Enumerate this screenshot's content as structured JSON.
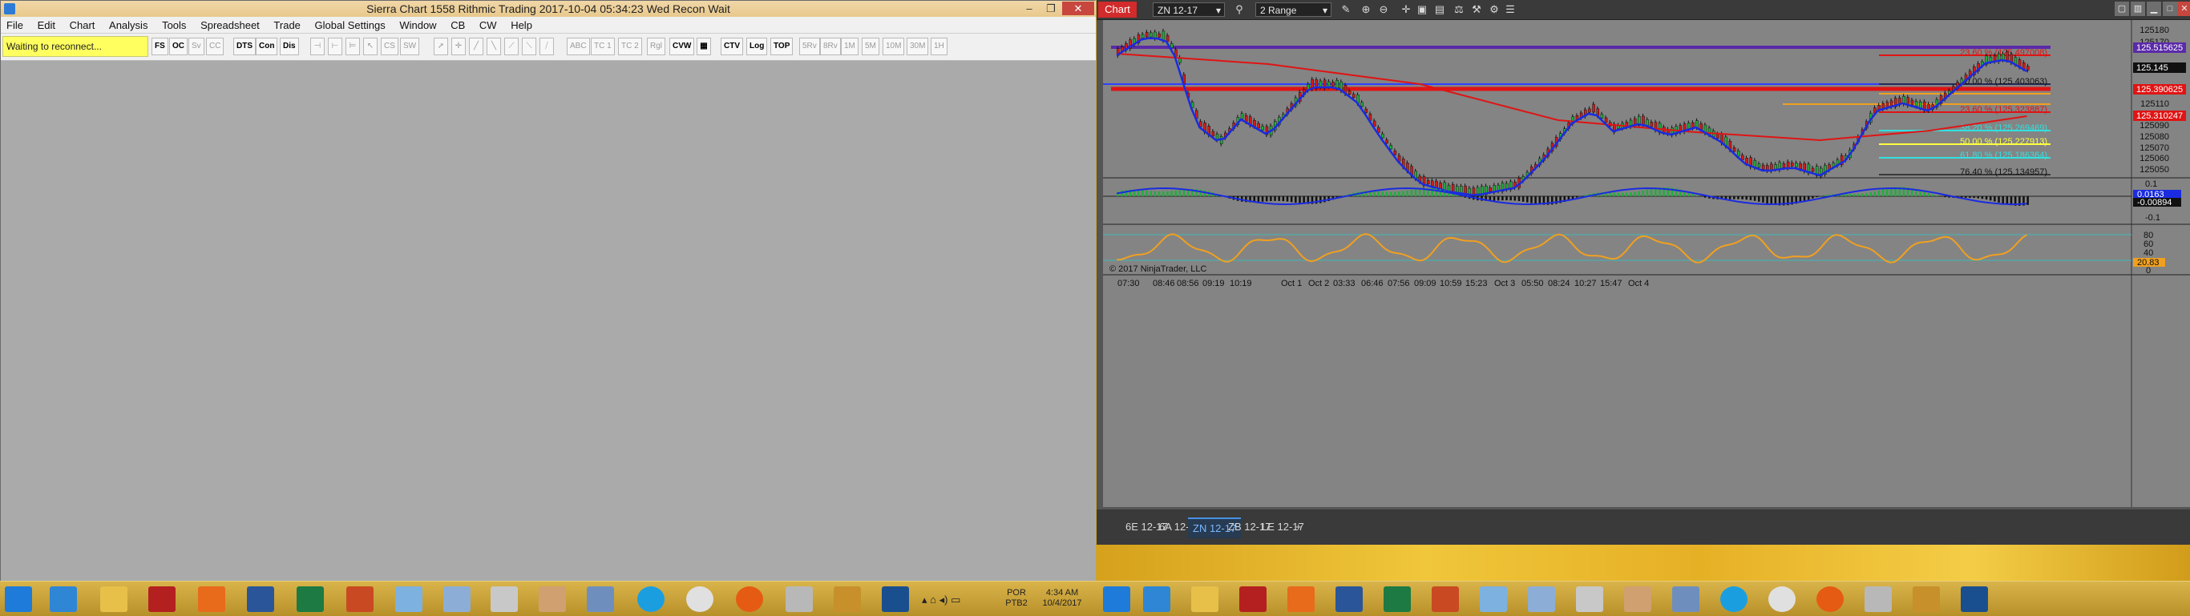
{
  "sierra": {
    "title": "Sierra Chart 1558 Rithmic Trading 2017-10-04  05:34:23 Wed  Recon Wait",
    "controls": {
      "minimize": "–",
      "restore": "❐",
      "close": "✕"
    },
    "menu": [
      "File",
      "Edit",
      "Chart",
      "Analysis",
      "Tools",
      "Spreadsheet",
      "Trade",
      "Global Settings",
      "Window",
      "CB",
      "CW",
      "Help"
    ],
    "status": "Waiting to reconnect...",
    "toolbar_buttons": [
      "FS",
      "OC",
      "Sv",
      "CC",
      "DTS",
      "Con",
      "Dis",
      "CVW",
      "CTV",
      "Log",
      "TOP"
    ],
    "toolbar_dim_buttons": [
      "Sv",
      "CC",
      "CS",
      "SW",
      "ABC",
      "TC 1",
      "TC 2",
      "Rgl",
      "5Rv",
      "8Rv",
      "1M",
      "5M",
      "10M",
      "30M",
      "1H"
    ]
  },
  "ninja": {
    "chart_tab": "Chart",
    "instrument": "ZN 12-17",
    "bar_type": "2 Range",
    "copyright": "© 2017 NinjaTrader, LLC",
    "tabs": [
      "6E 12-17",
      "6A 12-17",
      "ZN 12-17",
      "ZB 12-17",
      "LE 12-17",
      "+"
    ],
    "active_tab": "ZN 12-17"
  },
  "taskbar": {
    "lang_top": "POR",
    "lang_bottom": "PTB2",
    "time": "4:34 AM",
    "date": "10/4/2017"
  },
  "colors": {
    "title_bar": "#f1d7a8",
    "status_yellow": "#ffff60",
    "nt_red": "#d12b2b",
    "chart_bg": "#848484",
    "osc_orange": "#f0a020",
    "ema_blue": "#1a2be0",
    "sma_red": "#e01414"
  },
  "chart_data": {
    "type": "candlestick",
    "instrument": "ZN 12-17",
    "x_ticks": [
      "07:30",
      "08:46",
      "08:56",
      "09:19",
      "10:19",
      "Oct 1",
      "Oct 2",
      "03:33",
      "06:46",
      "07:56",
      "09:09",
      "10:59",
      "15:23",
      "Oct 3",
      "05:50",
      "08:24",
      "10:27",
      "15:47",
      "Oct 4"
    ],
    "price_ticks": [
      "125180",
      "125170",
      "125160",
      "125140",
      "125130",
      "125120",
      "125110",
      "125100",
      "125090",
      "125080",
      "125070",
      "125060",
      "125050"
    ],
    "price_labels": {
      "purple_line": "125.515625",
      "last_price": "125.145",
      "red_band": "125.390625",
      "red_low": "125.310247"
    },
    "fib_levels": [
      {
        "label": "23.60 % (125.497008)",
        "color": "#e01414"
      },
      {
        "label": "0.00 % (125.403063)",
        "color": "#222222"
      },
      {
        "label": "23.60 % (125.323887)",
        "color": "#e01414"
      },
      {
        "label": "38.20 % (125.269469)",
        "color": "#32e0e0"
      },
      {
        "label": "50.00 % (125.227913)",
        "color": "#ffff40"
      },
      {
        "label": "61.80 % (125.186364)",
        "color": "#32e0e0"
      },
      {
        "label": "76.40 % (125.134957)",
        "color": "#222222"
      }
    ],
    "macd": {
      "ticks": [
        "0.1",
        "0",
        "-0.1"
      ],
      "labels": [
        "0.0163",
        "-0.00894"
      ]
    },
    "oscillator": {
      "ticks": [
        "80",
        "60",
        "40",
        "20",
        "0"
      ],
      "last": "20.83"
    }
  }
}
